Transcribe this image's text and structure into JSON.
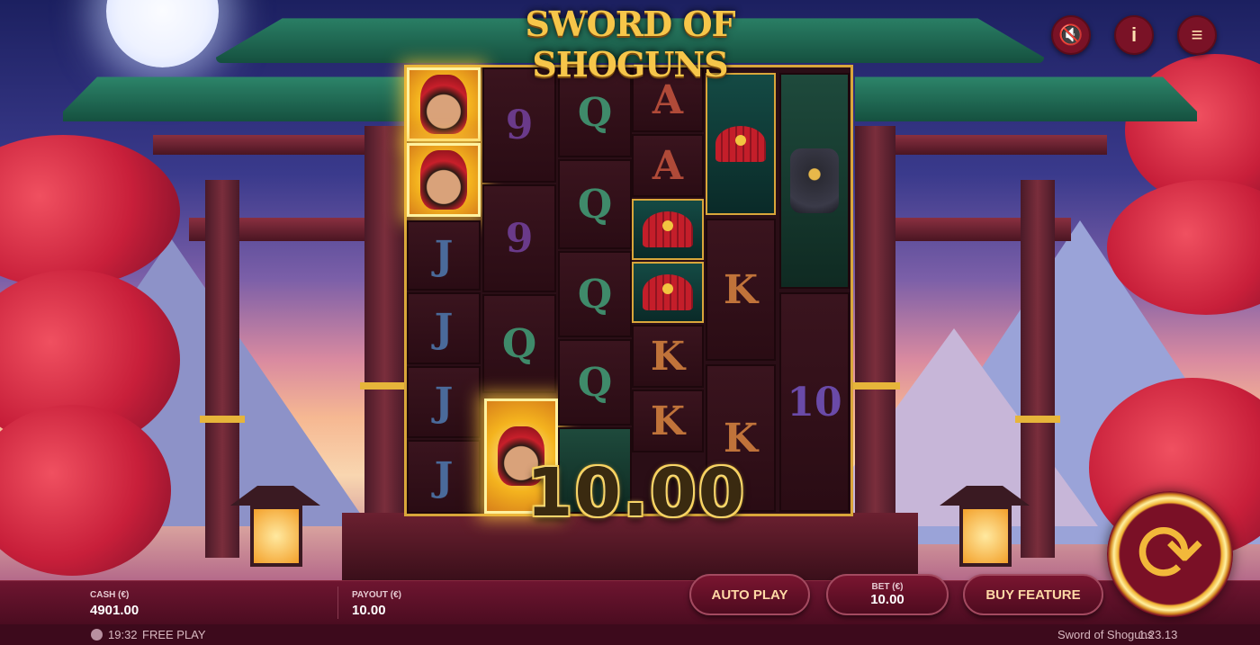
{
  "game": {
    "logo": "SWORD OF SHOGUNS",
    "win_amount": "10.00"
  },
  "header": {
    "sound_icon": "speaker-muted-icon",
    "info_label": "i",
    "menu_icon": "hamburger-menu-icon"
  },
  "reels": {
    "symbols": {
      "r1c1": "samurai-wild",
      "r1c2": "samurai-wild",
      "r1c3": "J",
      "r1c4": "J",
      "r1c5": "J",
      "r1c6": "J",
      "r2c1": "9",
      "r2c2": "9",
      "r2c3": "Q",
      "r2c4": "samurai-wild",
      "r3c1": "Q",
      "r3c2": "Q",
      "r3c3": "Q",
      "r3c4": "Q",
      "r4c1": "A",
      "r4c2": "A",
      "r4c3": "fan",
      "r4c4": "fan",
      "r4c5": "K",
      "r4c6": "K",
      "r5c1": "fan",
      "r5c2": "K",
      "r5c3": "K",
      "r6c1": "armor",
      "r6c2": "10"
    },
    "labels": {
      "nine": "9",
      "q": "Q",
      "a": "A",
      "j": "J",
      "k": "K",
      "ten": "10"
    }
  },
  "bottom_bar": {
    "cash_label": "CASH (€)",
    "cash_value": "4901.00",
    "payout_label": "PAYOUT (€)",
    "payout_value": "10.00",
    "auto_play_label": "AUTO PLAY",
    "bet_label": "BET (€)",
    "bet_value": "10.00",
    "buy_feature_label": "BUY FEATURE",
    "spin_icon": "spin-arrows-icon"
  },
  "footer": {
    "clock": "19:32",
    "mode": "FREE PLAY",
    "game_name": "Sword of Shoguns",
    "version": "1.23.13",
    "logo_icon": "provider-logo-icon"
  },
  "colors": {
    "accent_gold": "#d9a63a",
    "bar_bg": "#6e1530",
    "button_text": "#ffd9a6"
  }
}
